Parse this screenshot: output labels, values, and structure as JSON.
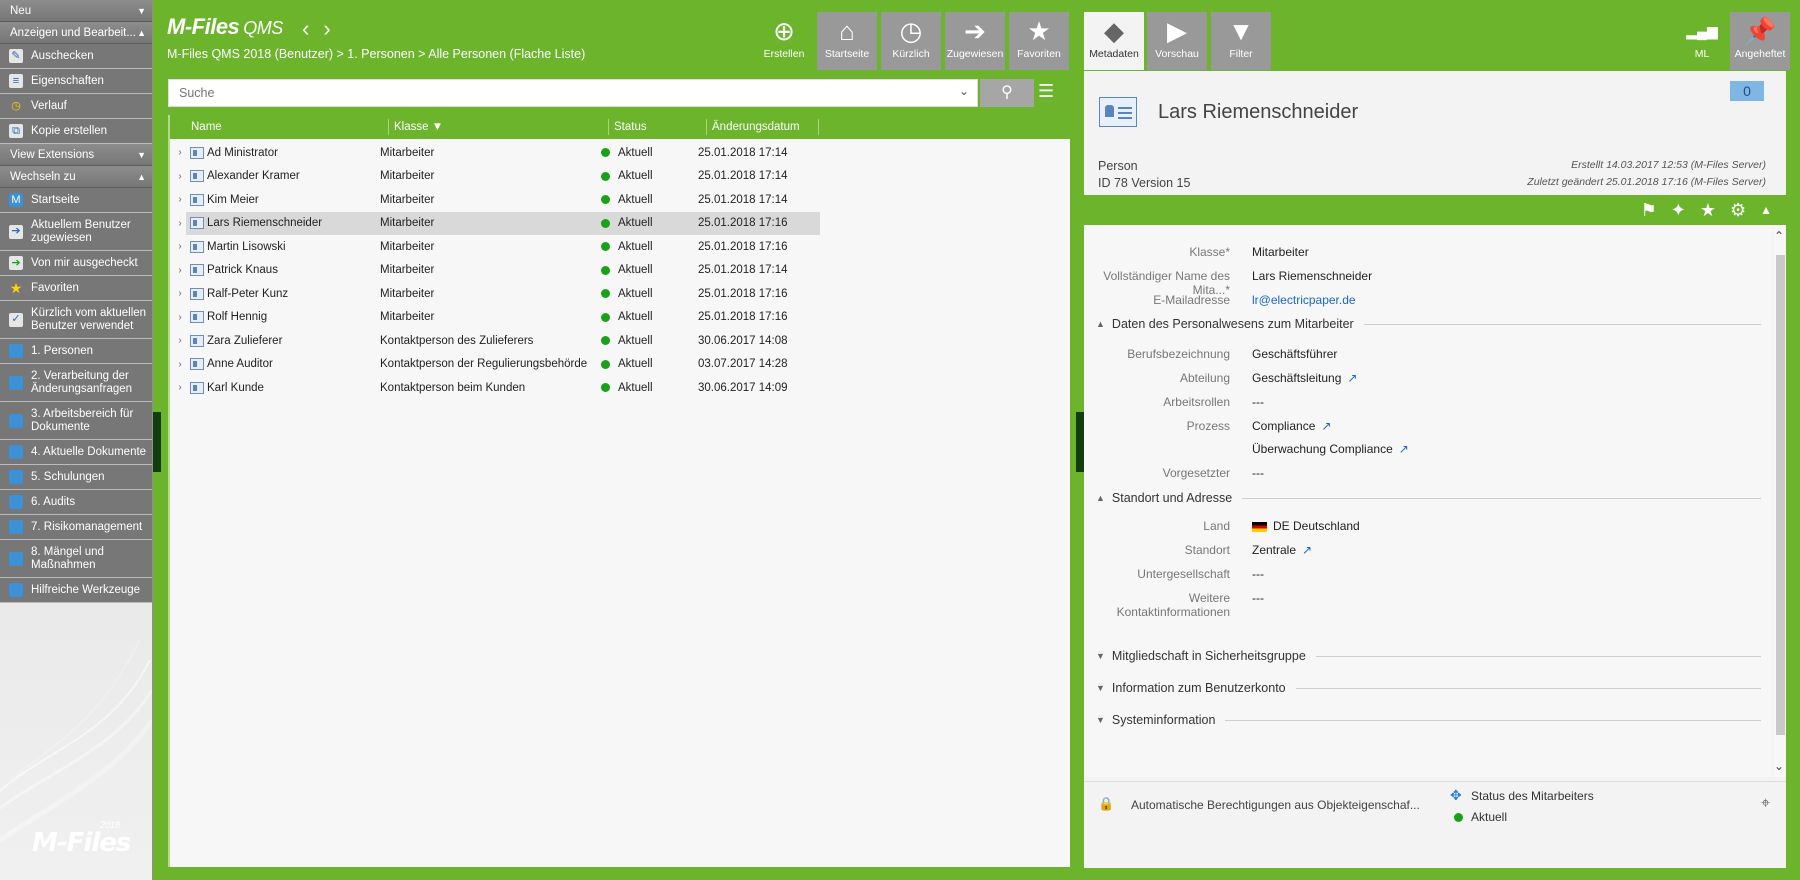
{
  "taskpane": {
    "sections": {
      "neu": "Neu",
      "anzeigen": "Anzeigen und Bearbeit...",
      "view_ext": "View Extensions",
      "wechseln": "Wechseln zu"
    },
    "actions": [
      "Auschecken",
      "Eigenschaften",
      "Verlauf",
      "Kopie erstellen"
    ],
    "goto": [
      "Startseite",
      "Aktuellem Benutzer zugewiesen",
      "Von mir ausgecheckt",
      "Favoriten",
      "Kürzlich vom aktuellen Benutzer verwendet",
      "1. Personen",
      "2. Verarbeitung der Änderungsanfragen",
      "3. Arbeitsbereich für Dokumente",
      "4. Aktuelle Dokumente",
      "5. Schulungen",
      "6. Audits",
      "7. Risikomanagement",
      "8. Mängel und Maßnahmen",
      "Hilfreiche Werkzeuge"
    ],
    "logo": "M-Files",
    "logo_year": "2018"
  },
  "header": {
    "brand": "M-Files",
    "brand_suffix": "QMS",
    "breadcrumb": "M-Files QMS 2018 (Benutzer) > 1. Personen > Alle Personen (Flache Liste)",
    "create": "Erstellen",
    "tabs": [
      "Startseite",
      "Kürzlich",
      "Zugewiesen",
      "Favoriten"
    ]
  },
  "search": {
    "placeholder": "Suche"
  },
  "list": {
    "columns": [
      "Name",
      "Klasse",
      "Status",
      "Änderungsdatum"
    ],
    "rows": [
      {
        "name": "Ad Ministrator",
        "klasse": "Mitarbeiter",
        "status": "Aktuell",
        "date": "25.01.2018 17:14"
      },
      {
        "name": "Alexander Kramer",
        "klasse": "Mitarbeiter",
        "status": "Aktuell",
        "date": "25.01.2018 17:14"
      },
      {
        "name": "Kim Meier",
        "klasse": "Mitarbeiter",
        "status": "Aktuell",
        "date": "25.01.2018 17:14"
      },
      {
        "name": "Lars Riemenschneider",
        "klasse": "Mitarbeiter",
        "status": "Aktuell",
        "date": "25.01.2018 17:16"
      },
      {
        "name": "Martin Lisowski",
        "klasse": "Mitarbeiter",
        "status": "Aktuell",
        "date": "25.01.2018 17:16"
      },
      {
        "name": "Patrick Knaus",
        "klasse": "Mitarbeiter",
        "status": "Aktuell",
        "date": "25.01.2018 17:14"
      },
      {
        "name": "Ralf-Peter Kunz",
        "klasse": "Mitarbeiter",
        "status": "Aktuell",
        "date": "25.01.2018 17:16"
      },
      {
        "name": "Rolf Hennig",
        "klasse": "Mitarbeiter",
        "status": "Aktuell",
        "date": "25.01.2018 17:16"
      },
      {
        "name": "Zara Zulieferer",
        "klasse": "Kontaktperson des Zulieferers",
        "status": "Aktuell",
        "date": "30.06.2017 14:08"
      },
      {
        "name": "Anne Auditor",
        "klasse": "Kontaktperson der Regulierungsbehörde",
        "status": "Aktuell",
        "date": "03.07.2017 14:28"
      },
      {
        "name": "Karl Kunde",
        "klasse": "Kontaktperson beim Kunden",
        "status": "Aktuell",
        "date": "30.06.2017 14:09"
      }
    ]
  },
  "right_tabs": [
    "Metadaten",
    "Vorschau",
    "Filter"
  ],
  "right_top": {
    "user": "ML",
    "pinned": "Angeheftet"
  },
  "object": {
    "title": "Lars Riemenschneider",
    "count": "0",
    "type": "Person",
    "id_version": "ID 78  Version 15",
    "created": "Erstellt 14.03.2017 12:53 (M-Files Server)",
    "modified": "Zuletzt geändert 25.01.2018 17:16 (M-Files Server)"
  },
  "props": {
    "klasse_lbl": "Klasse*",
    "klasse": "Mitarbeiter",
    "fullname_lbl": "Vollständiger Name des Mita...*",
    "fullname": "Lars Riemenschneider",
    "email_lbl": "E-Mailadresse",
    "email": "lr@electricpaper.de",
    "grp1": "Daten des Personalwesens zum Mitarbeiter",
    "beruf_lbl": "Berufsbezeichnung",
    "beruf": "Geschäftsführer",
    "abteilung_lbl": "Abteilung",
    "abteilung": "Geschäftsleitung",
    "rollen_lbl": "Arbeitsrollen",
    "rollen": "---",
    "prozess_lbl": "Prozess",
    "prozess1": "Compliance",
    "prozess2": "Überwachung Compliance",
    "vorg_lbl": "Vorgesetzter",
    "vorg": "---",
    "grp2": "Standort und Adresse",
    "land_lbl": "Land",
    "land": "DE Deutschland",
    "standort_lbl": "Standort",
    "standort": "Zentrale",
    "unterges_lbl": "Untergesellschaft",
    "unterges": "---",
    "weitere_lbl": "Weitere Kontaktinformationen",
    "weitere": "---",
    "grp3": "Mitgliedschaft in Sicherheitsgruppe",
    "grp4": "Information zum Benutzerkonto",
    "grp5": "Systeminformation"
  },
  "footer": {
    "autoperm": "Automatische Berechtigungen aus Objekteigenschaf...",
    "workflow": "Status des Mitarbeiters",
    "state": "Aktuell"
  },
  "colors": {
    "accent": "#6cb42c",
    "status_green": "#18a218",
    "link": "#1a66c2"
  }
}
